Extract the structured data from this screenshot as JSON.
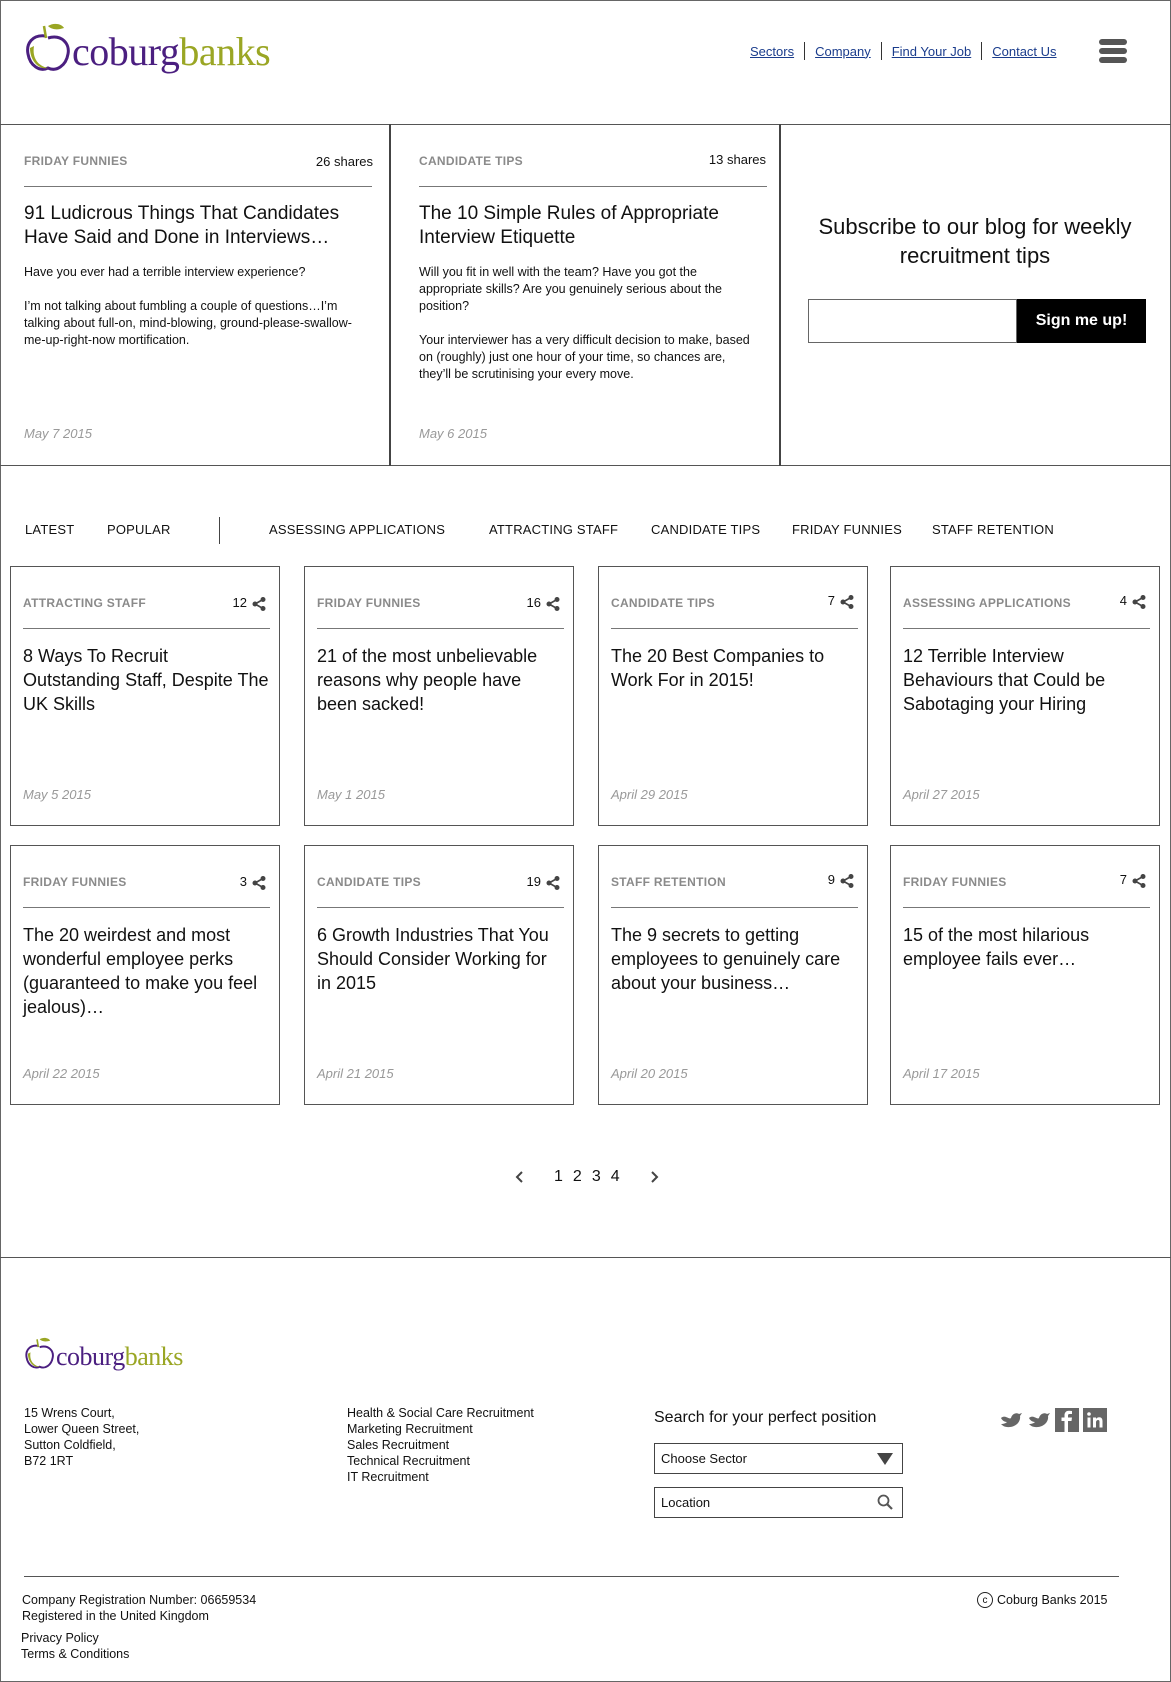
{
  "brand": {
    "word1": "coburg",
    "word2": "banks"
  },
  "nav": [
    {
      "label": "Sectors"
    },
    {
      "label": "Company"
    },
    {
      "label": "Find Your Job"
    },
    {
      "label": "Contact Us"
    }
  ],
  "featured": [
    {
      "category": "FRIDAY FUNNIES",
      "shares": "26 shares",
      "title": "91 Ludicrous Things That Candidates Have Said and Done in Interviews…",
      "excerpt": "Have you ever had a terrible interview experience?\n\nI’m not talking about fumbling a couple of questions…I’m talking about full-on, mind-blowing, ground-please-swallow-me-up-right-now mortification.",
      "date": "May 7 2015"
    },
    {
      "category": "CANDIDATE TIPS",
      "shares": "13 shares",
      "title": "The 10 Simple Rules of Appropriate Interview Etiquette",
      "excerpt": "Will you fit in well with the team? Have you got the appropriate skills? Are you genuinely serious about the position?\n\nYour interviewer has a very difficult decision to make, based on (roughly) just one hour of your time, so chances are, they’ll be scrutinising your every move.",
      "date": "May 6 2015"
    }
  ],
  "subscribe": {
    "title": "Subscribe to our blog for weekly recruitment tips",
    "button": "Sign me up!"
  },
  "filters": {
    "latest": "LATEST",
    "popular": "POPULAR",
    "categories": [
      "ASSESSING APPLICATIONS",
      "ATTRACTING STAFF",
      "CANDIDATE TIPS",
      "FRIDAY FUNNIES",
      "STAFF RETENTION"
    ]
  },
  "posts": [
    {
      "category": "ATTRACTING STAFF",
      "count": "12",
      "title": "8 Ways To Recruit Outstanding Staff, Despite The UK Skills",
      "date": "May 5 2015"
    },
    {
      "category": "FRIDAY FUNNIES",
      "count": "16",
      "title": "21 of the most unbelievable reasons why people have been sacked!",
      "date": "May 1 2015"
    },
    {
      "category": "CANDIDATE TIPS",
      "count": "7",
      "title": "The 20 Best Companies to Work For in 2015!",
      "date": "April 29 2015"
    },
    {
      "category": "ASSESSING APPLICATIONS",
      "count": "4",
      "title": "12 Terrible Interview Behaviours that Could be Sabotaging your Hiring",
      "date": "April 27 2015"
    },
    {
      "category": "FRIDAY FUNNIES",
      "count": "3",
      "title": "The 20 weirdest and most wonderful employee perks (guaranteed to make you feel jealous)…",
      "date": "April 22 2015"
    },
    {
      "category": "CANDIDATE TIPS",
      "count": "19",
      "title": "6 Growth Industries That You Should Consider Working for in 2015",
      "date": "April 21 2015"
    },
    {
      "category": "STAFF RETENTION",
      "count": "9",
      "title": "The 9 secrets to getting employees to genuinely care about your business…",
      "date": "April 20 2015"
    },
    {
      "category": "FRIDAY FUNNIES",
      "count": "7",
      "title": "15 of the most hilarious employee fails ever…",
      "date": "April 17 2015"
    }
  ],
  "pagination": {
    "pages": [
      "1",
      "2",
      "3",
      "4"
    ]
  },
  "footer": {
    "address": [
      "15 Wrens Court,",
      "Lower Queen Street,",
      "Sutton Coldfield,",
      "B72 1RT"
    ],
    "services": [
      "Health & Social Care Recruitment",
      "Marketing Recruitment",
      "Sales Recruitment",
      "Technical Recruitment",
      "IT Recruitment"
    ],
    "search_title": "Search for your perfect position",
    "sector_placeholder": "Choose Sector",
    "location_placeholder": "Location",
    "registration": "Company Registration Number: 06659534",
    "registered": "Registered in the United Kingdom",
    "privacy": "Privacy Policy",
    "terms": "Terms & Conditions",
    "copyright": "Coburg Banks 2015",
    "copyright_symbol": "c"
  },
  "colors": {
    "brand_purple": "#4b1f80",
    "brand_green": "#9aa624",
    "nav_link": "#1a3c8c",
    "muted": "#8a8a8a"
  }
}
